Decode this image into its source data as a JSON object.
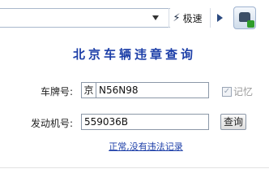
{
  "toolbar": {
    "speed_label": "极速",
    "icons": [
      "chevron-down-icon",
      "lightning-icon",
      "play-icon",
      "car-extension-icon"
    ]
  },
  "popup": {
    "title": "北京车辆违章查询",
    "plate_label": "车牌号:",
    "plate_prefix": "京",
    "plate_value": "N56N98",
    "remember_label": "记忆",
    "remember_checked": true,
    "engine_label": "发动机号:",
    "engine_value": "559036B",
    "query_button": "查询",
    "result_text": "正常,没有违法记录"
  },
  "colors": {
    "title": "#1d3fa8",
    "link": "#1d3fa8",
    "extension_badge": "#2f9d2a"
  }
}
